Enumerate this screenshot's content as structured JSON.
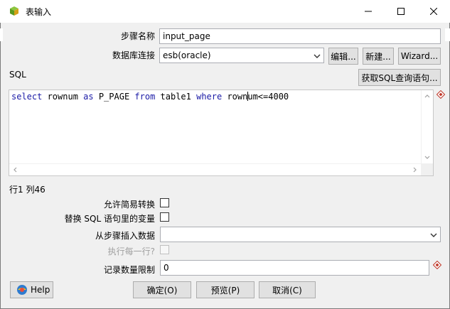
{
  "window": {
    "title": "表输入",
    "accent": "#1e73be"
  },
  "form": {
    "step_name_label": "步骤名称",
    "step_name_value": "input_page",
    "db_conn_label": "数据库连接",
    "db_conn_value": "esb(oracle)",
    "edit_button": "编辑...",
    "new_button": "新建...",
    "wizard_button": "Wizard...",
    "sql_label": "SQL",
    "get_sql_button": "获取SQL查询语句...",
    "sql_code": {
      "kw1": "select",
      "t1": " rownum ",
      "kw2": "as",
      "t2": " P_PAGE ",
      "kw3": "from",
      "t3": " table1 ",
      "kw4": "where",
      "t4a": " rown",
      "t4b": "um<=4000"
    },
    "cursor_position": "行1 列46",
    "lazy_conversion_label": "允许简易转换",
    "replace_vars_label": "替换 SQL 语句里的变量",
    "insert_from_step_label": "从步骤插入数据",
    "insert_from_step_value": "",
    "execute_each_row_label": "执行每一行?",
    "limit_label": "记录数量限制",
    "limit_value": "0"
  },
  "footer": {
    "help_button": "Help",
    "ok_button": "确定(O)",
    "preview_button": "预览(P)",
    "cancel_button": "取消(C)"
  },
  "checkboxes": {
    "lazy_conversion": false,
    "replace_vars": false,
    "execute_each_row": false
  }
}
